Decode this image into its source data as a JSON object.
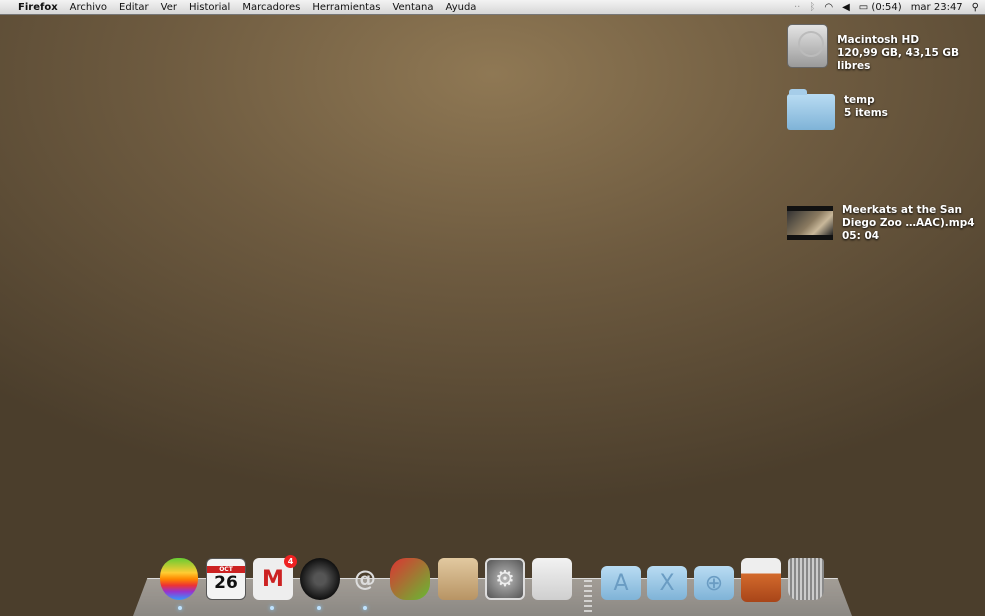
{
  "menubar": {
    "apple": "",
    "app": "Firefox",
    "items": [
      "Archivo",
      "Editar",
      "Ver",
      "Historial",
      "Marcadores",
      "Herramientas",
      "Ventana",
      "Ayuda"
    ],
    "status": {
      "battery": "(0:54)",
      "clock": "mar 23:47"
    }
  },
  "desktop": [
    {
      "name": "Macintosh HD",
      "sub": "120,99 GB, 43,15 GB libres"
    },
    {
      "name": "temp",
      "sub": "5 items"
    },
    {
      "name1": "Meerkats at the San",
      "name2": "Diego Zoo …AAC).mp4",
      "sub": "05: 04"
    }
  ],
  "dock": {
    "calendar_month": "OCT",
    "calendar_day": "26",
    "mail_badge": "4"
  }
}
